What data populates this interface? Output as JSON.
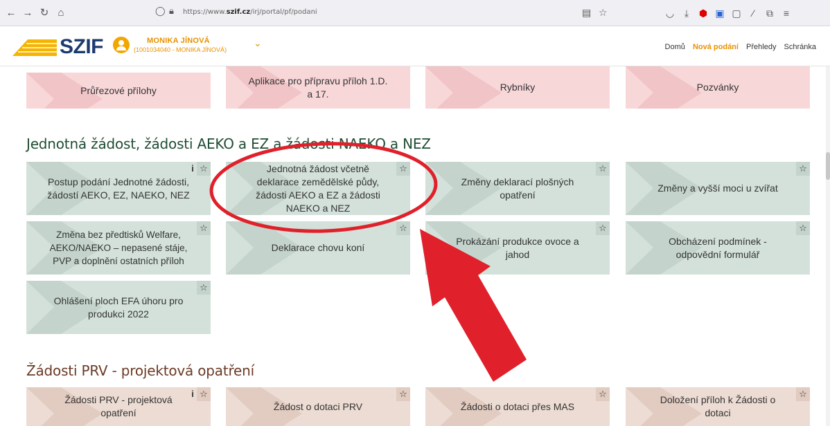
{
  "browser": {
    "url_prefix": "https://www.",
    "url_host": "szif.cz",
    "url_path": "/irj/portal/pf/podani"
  },
  "header": {
    "logo": "SZIF",
    "user_name": "MONIKA JÍNOVÁ",
    "user_sub": "(1001034040 - MONIKA JÍNOVÁ)",
    "nav": [
      "Domů",
      "Nová podání",
      "Přehledy",
      "Schránka"
    ],
    "active_nav": "Nová podání"
  },
  "sections": {
    "top_row": [
      {
        "label": "Průřezové přílohy"
      },
      {
        "label": "Aplikace pro přípravu příloh 1.D. a 17."
      },
      {
        "label": "Rybníky"
      },
      {
        "label": "Pozvánky"
      }
    ],
    "jz": {
      "title": "Jednotná žádost, žádosti AEKO a EZ a žádosti NAEKO a NEZ",
      "tiles": [
        {
          "label": "Postup podání Jednotné žádosti, žádostí AEKO, EZ, NAEKO, NEZ"
        },
        {
          "label": "Jednotná žádost včetně deklarace zemědělské půdy, žádosti AEKO a EZ a žádosti NAEKO a NEZ"
        },
        {
          "label": "Změny deklarací plošných opatření"
        },
        {
          "label": "Změny a vyšší moci u zvířat"
        },
        {
          "label": "Změna bez předtisků Welfare, AEKO/NAEKO – nepasené stáje, PVP a doplnění ostatních příloh"
        },
        {
          "label": "Deklarace chovu koní"
        },
        {
          "label": "Prokázání produkce ovoce a jahod"
        },
        {
          "label": "Obcházení podmínek - odpovědní formulář"
        },
        {
          "label": "Ohlášení ploch EFA úhoru pro produkci 2022"
        }
      ]
    },
    "prv": {
      "title": "Žádosti PRV - projektová opatření",
      "tiles": [
        {
          "label": "Žádosti PRV - projektová opatření"
        },
        {
          "label": "Žádost o dotaci PRV"
        },
        {
          "label": "Žádosti o dotaci přes MAS"
        },
        {
          "label": "Doložení příloh k Žádosti o dotaci"
        }
      ]
    }
  },
  "icons": {
    "star": "☆",
    "info": "i"
  },
  "colors": {
    "accent": "#e99000",
    "brand": "#1c3a6e",
    "tile_pink": "#f8d7d9",
    "tile_green": "#d3e1da",
    "tile_tan": "#eddcd4",
    "annotation_red": "#e0202a"
  }
}
